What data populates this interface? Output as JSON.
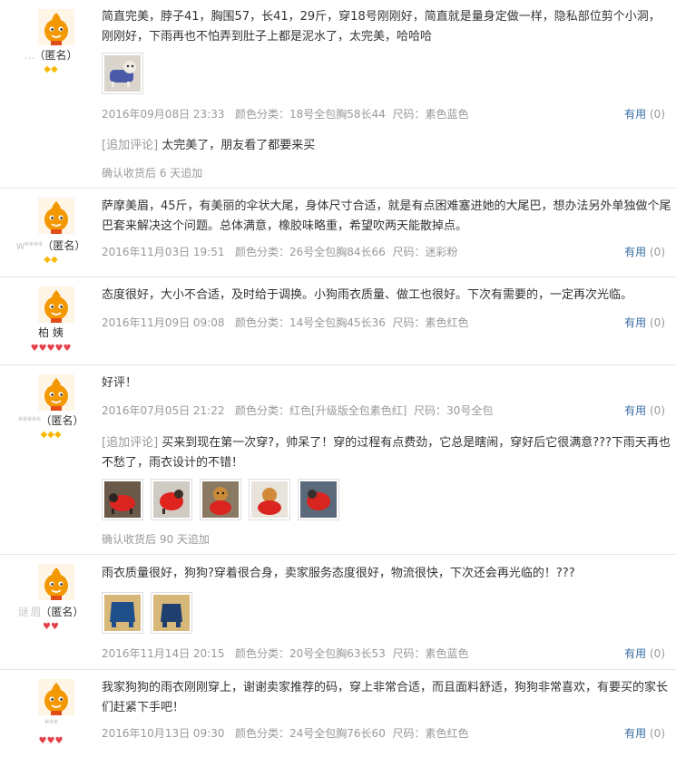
{
  "helpful_label": "有用",
  "spec_label": "颜色分类：",
  "size_label": "尺码：",
  "reviews": [
    {
      "user_visible": "（匿名）",
      "user_blur": "…",
      "rank": "◆◆",
      "text": "简直完美，脖子41，胸围57，长41，29斤，穿18号刚刚好，简直就是量身定做一样，隐私部位剪个小洞，刚刚好，下雨再也不怕弄到肚子上都是泥水了，太完美，哈哈哈",
      "date": "2016年09月08日 23:33",
      "color": "18号全包胸58长44",
      "size": "素色蓝色",
      "helpful": "(0)",
      "append_tag": "[追加评论]",
      "append_text": "太完美了，朋友看了都要来买",
      "after_text": "确认收货后 6 天追加"
    },
    {
      "user_visible": "（匿名）",
      "user_blur": "w****",
      "rank": "◆◆",
      "text": "萨摩美眉，45斤，有美丽的伞状大尾，身体尺寸合适，就是有点困难塞进她的大尾巴，想办法另外单独做个尾巴套来解决这个问题。总体满意，橡胶味略重，希望吹两天能散掉点。",
      "date": "2016年11月03日 19:51",
      "color": "26号全包胸84长66",
      "size": "迷彩粉",
      "helpful": "(0)"
    },
    {
      "user_visible": "柏  姨",
      "user_blur": "",
      "rank": "♥♥♥♥♥",
      "text": "态度很好，大小不合适，及时给于调换。小狗雨衣质量、做工也很好。下次有需要的，一定再次光临。",
      "date": "2016年11月09日 09:08",
      "color": "14号全包胸45长36",
      "size": "素色红色",
      "helpful": "(0)"
    },
    {
      "user_visible": "（匿名）",
      "user_blur": "*****",
      "rank": "◆◆◆",
      "text": "好评！",
      "date": "2016年07月05日 21:22",
      "color": "红色[升级版全包素色红]",
      "size": "30号全包",
      "helpful": "(0)",
      "append_tag": "[追加评论]",
      "append_text": "买来到现在第一次穿?，帅呆了！穿的过程有点费劲，它总是瞎闹，穿好后它很满意???下雨天再也不愁了，雨衣设计的不错！",
      "after_text": "确认收货后 90 天追加"
    },
    {
      "user_visible": "（匿名）",
      "user_blur": "谜  眉",
      "rank": "♥♥",
      "text": "雨衣质量很好，狗狗?穿着很合身，卖家服务态度很好，物流很快，下次还会再光临的！???",
      "date": "2016年11月14日 20:15",
      "color": "20号全包胸63长53",
      "size": "素色蓝色",
      "helpful": "(0)"
    },
    {
      "user_visible": "",
      "user_blur": "***",
      "rank": "♥♥♥",
      "text": "我家狗狗的雨衣刚刚穿上，谢谢卖家推荐的码，穿上非常合适，而且面料舒适，狗狗非常喜欢，有要买的家长们赶紧下手吧！",
      "date": "2016年10月13日 09:30",
      "color": "24号全包胸76长60",
      "size": "素色红色",
      "helpful": "(0)"
    }
  ],
  "colors": {
    "helpful_link": "#3a6ea5",
    "meta_gray": "#999999",
    "rank_yellow": "#f6b800",
    "rank_red": "#e5414a",
    "avatar_orange": "#f39800"
  }
}
